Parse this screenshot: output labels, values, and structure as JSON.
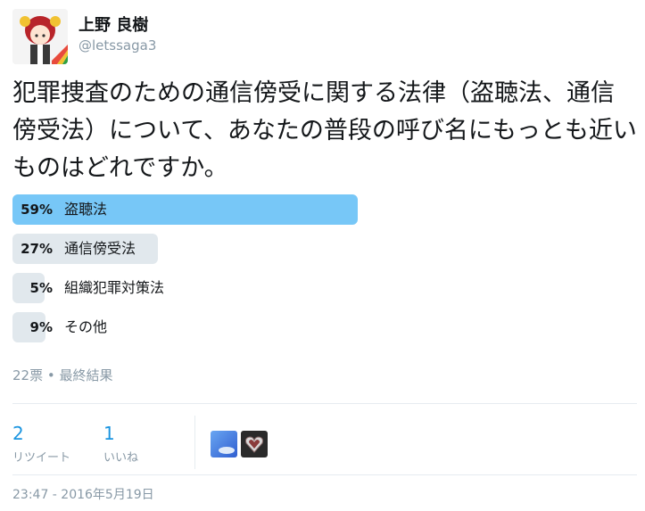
{
  "user": {
    "display_name": "上野 良樹",
    "handle": "@letssaga3",
    "avatar_icon": "anime-girl-avatar-icon"
  },
  "tweet": {
    "text": "犯罪捜査のための通信傍受に関する法律（盗聴法、通信傍受法）について、あなたの普段の呼び名にもっとも近いものはどれですか。"
  },
  "poll": {
    "options": [
      {
        "percent": "59%",
        "label": "盗聴法",
        "fraction": 0.59,
        "winner": true
      },
      {
        "percent": "27%",
        "label": "通信傍受法",
        "fraction": 0.27,
        "winner": false
      },
      {
        "percent": "5%",
        "label": "組織犯罪対策法",
        "fraction": 0.05,
        "winner": false
      },
      {
        "percent": "9%",
        "label": "その他",
        "fraction": 0.09,
        "winner": false
      }
    ],
    "meta": "22票 • 最終結果"
  },
  "stats": {
    "retweets_count": "2",
    "retweets_label": "リツイート",
    "likes_count": "1",
    "likes_label": "いいね"
  },
  "likers": [
    "sky-avatar-icon",
    "heart-avatar-icon"
  ],
  "timestamp": "23:47 - 2016年5月19日",
  "colors": {
    "winner_bar": "#77c7f7",
    "bar": "#e1e8ed",
    "link": "#1b95e0",
    "muted": "#8899a6"
  }
}
